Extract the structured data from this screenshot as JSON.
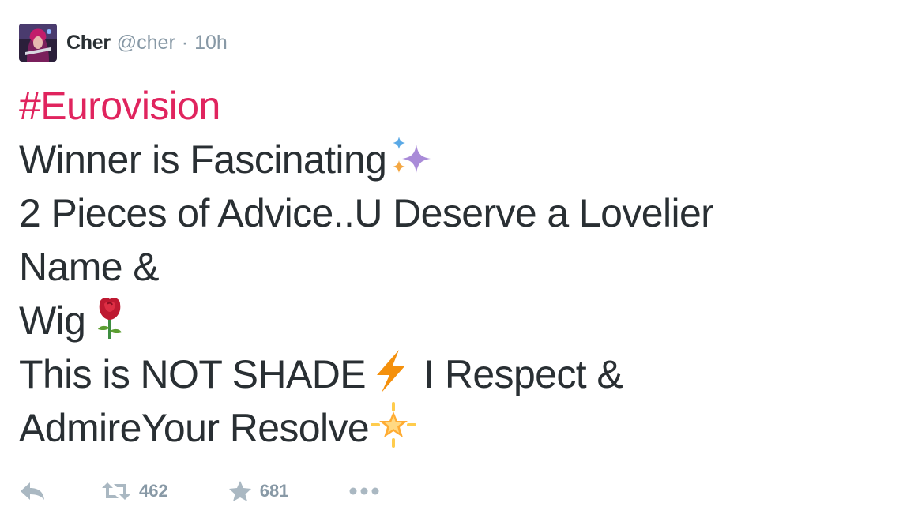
{
  "tweet": {
    "author": {
      "name": "Cher",
      "handle": "@cher",
      "separator": "·",
      "time": "10h",
      "avatar_icon": "avatar-photo"
    },
    "text": {
      "hashtag": "#Eurovision",
      "line1": "Winner is Fascinating",
      "line1_emoji": "sparkles-icon",
      "line2": "2 Pieces of Advice..U Deserve a Lovelier",
      "line3": "Name &",
      "line4": "Wig",
      "line4_emoji": "rose-icon",
      "line5a": "This is NOT SHADE",
      "line5_emoji": "lightning-icon",
      "line5b": " I Respect &",
      "line6": "AdmireYour Resolve",
      "line6_emoji": "glowing-star-icon"
    },
    "actions": {
      "retweet_count": "462",
      "favorite_count": "681",
      "icons": [
        "reply-icon",
        "retweet-icon",
        "star-icon",
        "more-icon"
      ]
    },
    "colors": {
      "hashtag": "#e0245e",
      "text": "#292f33",
      "muted": "#8899a6",
      "action_icon": "#aab8c2"
    }
  }
}
